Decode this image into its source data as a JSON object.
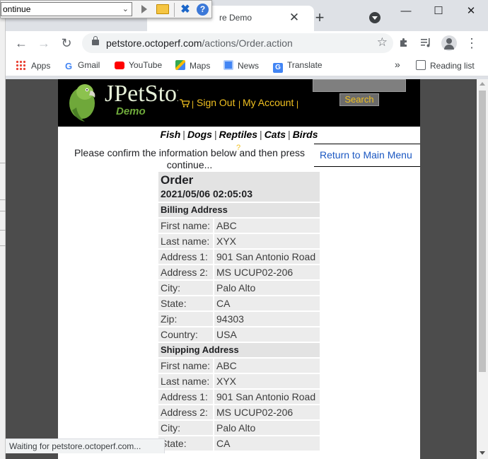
{
  "floating_toolbar": {
    "combo_value": "ontinue"
  },
  "tab": {
    "title": "re Demo",
    "close_glyph": "✕",
    "newtab_glyph": "+"
  },
  "window_controls": {
    "minimize": "—",
    "maximize": "☐",
    "close": "✕"
  },
  "toolbar": {
    "back": "←",
    "forward": "→",
    "reload": "↻",
    "url_host": "petstore.octoperf.com",
    "url_path": "/actions/Order.action",
    "star": "☆",
    "menu": "⋮"
  },
  "bookmarks": {
    "items": [
      {
        "label": "Apps",
        "icon": "apps-grid-icon"
      },
      {
        "label": "Gmail",
        "icon": "google-icon"
      },
      {
        "label": "YouTube",
        "icon": "youtube-icon"
      },
      {
        "label": "Maps",
        "icon": "maps-icon"
      },
      {
        "label": "News",
        "icon": "news-icon"
      },
      {
        "label": "Translate",
        "icon": "translate-icon"
      }
    ],
    "overflow": "»",
    "reading_list": "Reading list"
  },
  "store": {
    "logo": "JPetStore",
    "logo_demo": "Demo",
    "sign_out": "Sign Out",
    "my_account": "My Account",
    "help": "?",
    "search_button": "Search",
    "categories": [
      "Fish",
      "Dogs",
      "Reptiles",
      "Cats",
      "Birds"
    ],
    "confirm_text": "Please confirm the information below and then press continue...",
    "return_link": "Return to Main Menu"
  },
  "order": {
    "title": "Order",
    "date": "2021/05/06 02:05:03",
    "billing_title": "Billing Address",
    "billing": [
      {
        "k": "First name:",
        "v": "ABC"
      },
      {
        "k": "Last name:",
        "v": "XYX"
      },
      {
        "k": "Address 1:",
        "v": "901 San Antonio Road"
      },
      {
        "k": "Address 2:",
        "v": "MS UCUP02-206"
      },
      {
        "k": "City:",
        "v": "Palo Alto"
      },
      {
        "k": "State:",
        "v": "CA"
      },
      {
        "k": "Zip:",
        "v": "94303"
      },
      {
        "k": "Country:",
        "v": "USA"
      }
    ],
    "shipping_title": "Shipping Address",
    "shipping": [
      {
        "k": "First name:",
        "v": "ABC"
      },
      {
        "k": "Last name:",
        "v": "XYX"
      },
      {
        "k": "Address 1:",
        "v": "901 San Antonio Road"
      },
      {
        "k": "Address 2:",
        "v": "MS UCUP02-206"
      },
      {
        "k": "City:",
        "v": "Palo Alto"
      },
      {
        "k": "State:",
        "v": "CA"
      }
    ]
  },
  "status_bar": "Waiting for petstore.octoperf.com..."
}
